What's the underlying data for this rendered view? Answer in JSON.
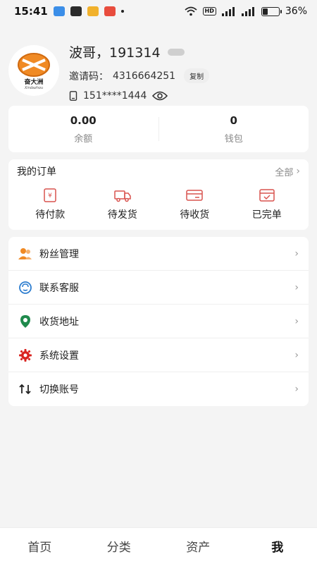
{
  "status_bar": {
    "time": "15:41",
    "battery_percent_text": "36%",
    "battery_level": 0.36,
    "network_badge": "HD",
    "app_icon_colors": [
      "#3b8ee8",
      "#2a2a2a",
      "#f1b12c",
      "#e84c3d"
    ]
  },
  "profile": {
    "name": "波哥，191314",
    "invite_label": "邀请码：",
    "invite_code": "4316664251",
    "copy_label": "复制",
    "phone": "151****1444",
    "avatar_brand": "奋大洲",
    "avatar_sub": "Xindazhou"
  },
  "balance": {
    "balance_value": "0.00",
    "balance_label": "余额",
    "wallet_value": "0",
    "wallet_label": "钱包"
  },
  "orders": {
    "title": "我的订单",
    "all_label": "全部",
    "items": [
      {
        "label": "待付款",
        "icon": "payment-icon"
      },
      {
        "label": "待发货",
        "icon": "truck-icon"
      },
      {
        "label": "待收货",
        "icon": "receive-icon"
      },
      {
        "label": "已完单",
        "icon": "completed-icon"
      }
    ]
  },
  "menu": {
    "items": [
      {
        "label": "粉丝管理",
        "icon": "fans-icon"
      },
      {
        "label": "联系客服",
        "icon": "customer-service-icon"
      },
      {
        "label": "收货地址",
        "icon": "location-icon"
      },
      {
        "label": "系统设置",
        "icon": "gear-icon"
      },
      {
        "label": "切换账号",
        "icon": "switch-icon"
      }
    ]
  },
  "bottom_nav": {
    "items": [
      {
        "label": "首页"
      },
      {
        "label": "分类"
      },
      {
        "label": "资产"
      },
      {
        "label": "我"
      }
    ],
    "active_index": 3
  },
  "colors": {
    "accent_red": "#d9534f",
    "accent_orange": "#f08a24",
    "accent_green": "#1f8a4c",
    "accent_blue": "#2e7ed0"
  }
}
